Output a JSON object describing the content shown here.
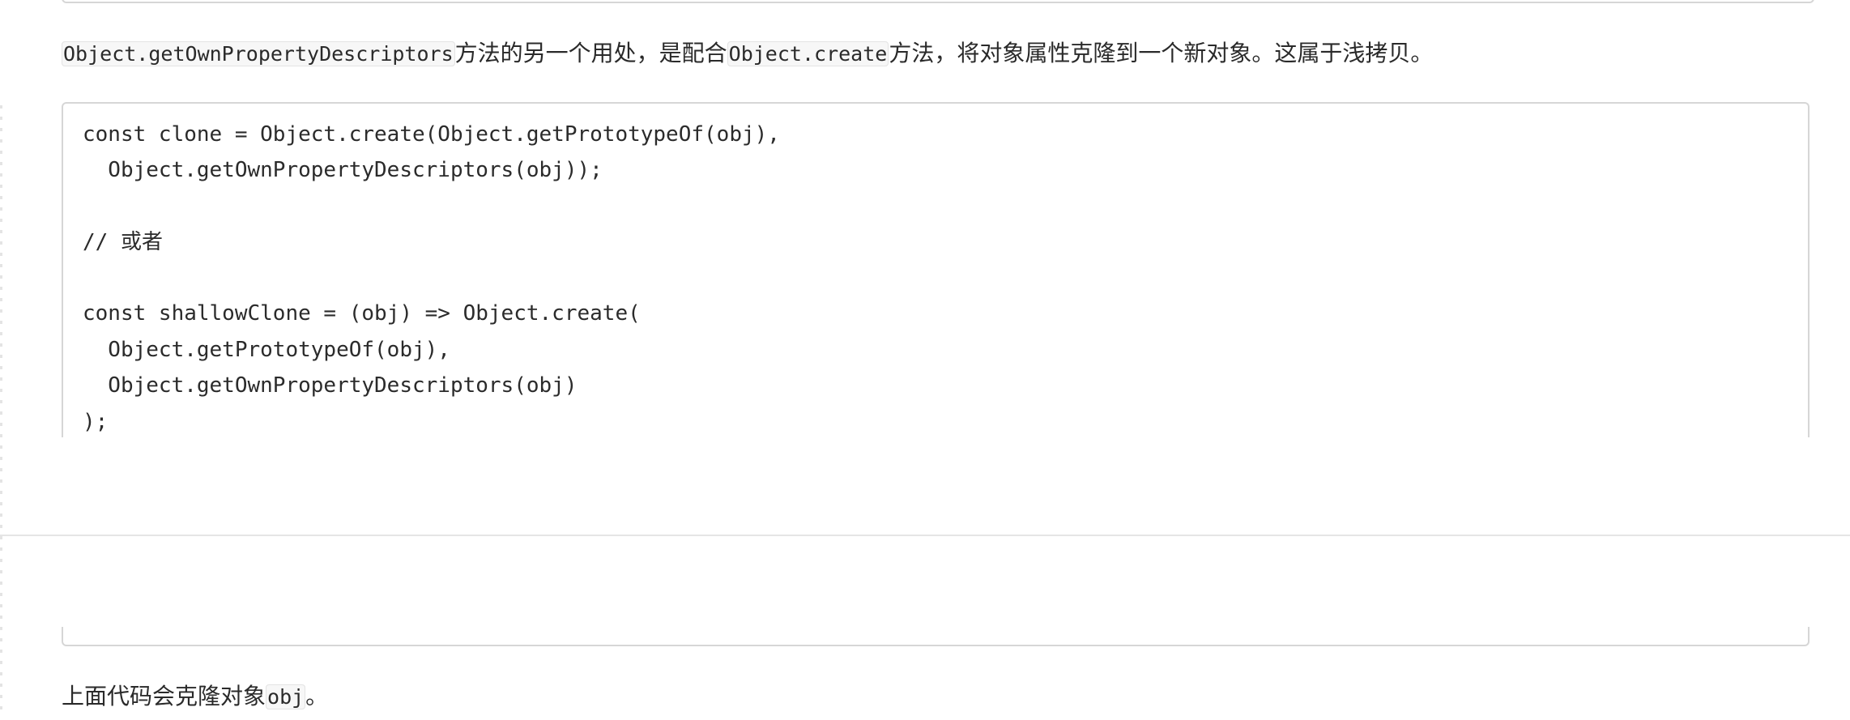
{
  "paragraphs": {
    "first": {
      "code_1": "Object.getOwnPropertyDescriptors",
      "text_1": "方法的另一个用处，是配合",
      "code_2": "Object.create",
      "text_2": "方法，将对象属性克隆到一个新对象。这属于浅拷贝。"
    },
    "second": {
      "text_1": "上面代码会克隆对象",
      "code_1": "obj",
      "text_2": "。"
    }
  },
  "code_block": {
    "lines": [
      "const clone = Object.create(Object.getPrototypeOf(obj),",
      "  Object.getOwnPropertyDescriptors(obj));",
      "",
      "// 或者",
      "",
      "const shallowClone = (obj) => Object.create(",
      "  Object.getPrototypeOf(obj),",
      "  Object.getOwnPropertyDescriptors(obj)",
      ");"
    ]
  }
}
